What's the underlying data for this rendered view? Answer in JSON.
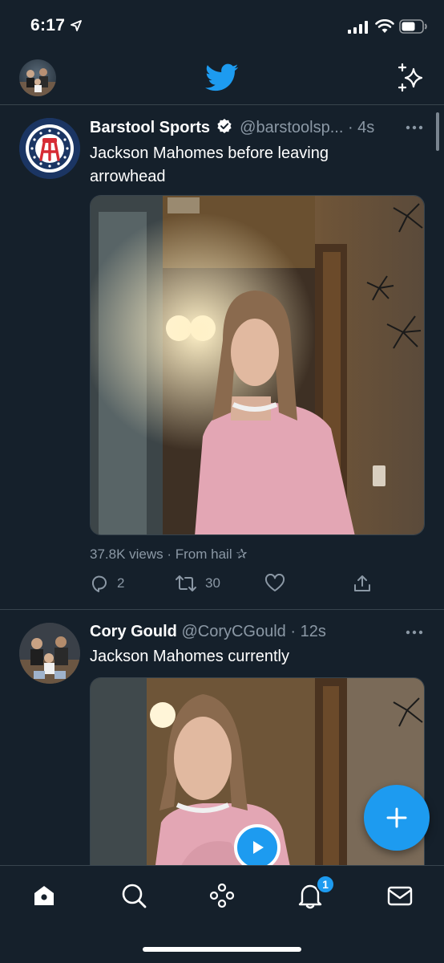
{
  "status_bar": {
    "time": "6:17",
    "location_icon": "location-arrow-icon",
    "signal_icon": "cellular-signal-icon",
    "wifi_icon": "wifi-icon",
    "battery_icon": "battery-icon"
  },
  "header": {
    "logo_icon": "twitter-bird-icon",
    "profile_icon": "profile-avatar",
    "sparkle_icon": "sparkle-icon"
  },
  "tweets": [
    {
      "name": "Barstool Sports",
      "verified": true,
      "handle": "@barstoolsp...",
      "time": "· 4s",
      "text": "Jackson Mahomes before leaving arrowhead",
      "views": "37.8K views · From hail ✰",
      "replies": "2",
      "retweets": "30",
      "likes": "",
      "media": "video-thumbnail"
    },
    {
      "name": "Cory Gould",
      "verified": false,
      "handle": "@CoryCGould",
      "time": "· 12s",
      "text": "Jackson Mahomes currently",
      "media": "video-thumbnail"
    }
  ],
  "tab_bar": {
    "items": [
      "home-icon",
      "search-icon",
      "spaces-icon",
      "notifications-icon",
      "messages-icon"
    ],
    "notification_badge": "1"
  },
  "colors": {
    "background": "#15202b",
    "accent": "#1d9bf0",
    "muted_text": "#8b98a5",
    "divider": "#38444d"
  }
}
